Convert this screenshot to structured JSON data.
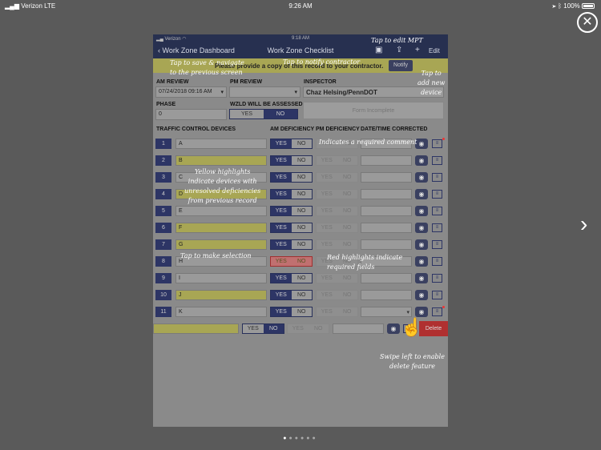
{
  "status": {
    "carrier": "Verizon",
    "network": "LTE",
    "time": "9:26 AM",
    "battery": "100%"
  },
  "close_glyph": "✕",
  "next_glyph": "›",
  "device": {
    "carrier": "Verizon",
    "time": "9:18 AM"
  },
  "nav": {
    "back": "Work Zone Dashboard",
    "title": "Work Zone Checklist",
    "edit": "Edit"
  },
  "notice": {
    "text": "Please provide a copy of this record to your contractor.",
    "notify": "Notify"
  },
  "form": {
    "am_review_label": "AM REVIEW",
    "am_review_value": "07/24/2018 09:16 AM",
    "pm_review_label": "PM REVIEW",
    "pm_review_value": "",
    "inspector_label": "INSPECTOR",
    "inspector_value": "Chaz Helsing/PennDOT",
    "phase_label": "PHASE",
    "phase_value": "0",
    "wzld_label": "WZLD WILL BE ASSESSED",
    "form_incomplete": "Form Incomplete"
  },
  "table": {
    "headers": [
      "TRAFFIC CONTROL DEVICES",
      "AM DEFICIENCY",
      "PM DEFICIENCY",
      "DATE/TIME CORRECTED"
    ],
    "yes": "YES",
    "no": "NO",
    "delete": "Delete",
    "rows": [
      {
        "num": "1",
        "name": "A",
        "yellow": false
      },
      {
        "num": "2",
        "name": "B",
        "yellow": true
      },
      {
        "num": "3",
        "name": "C",
        "yellow": false
      },
      {
        "num": "4",
        "name": "D",
        "yellow": true
      },
      {
        "num": "5",
        "name": "E",
        "yellow": false
      },
      {
        "num": "6",
        "name": "F",
        "yellow": true
      },
      {
        "num": "7",
        "name": "G",
        "yellow": true
      },
      {
        "num": "8",
        "name": "H",
        "yellow": false
      },
      {
        "num": "9",
        "name": "I",
        "yellow": false
      },
      {
        "num": "10",
        "name": "J",
        "yellow": true
      },
      {
        "num": "11",
        "name": "K",
        "yellow": false
      }
    ]
  },
  "annotations": {
    "edit_mpt": "Tap to edit MPT",
    "save_nav": "Tap to save & navigate\nto the previous screen",
    "notify_contractor": "Tap to notify contractor",
    "add_device": "Tap to\nadd new\ndevice",
    "required_comment": "Indicates a required comment",
    "yellow_highlights": "Yellow highlights\nindicate devices with\nunresolved deficiencies\nfrom previous record",
    "make_selection": "Tap to make selection",
    "red_highlights": "Red highlights indicate\nrequired fields",
    "swipe_delete": "Swipe left to enable\ndelete feature"
  }
}
